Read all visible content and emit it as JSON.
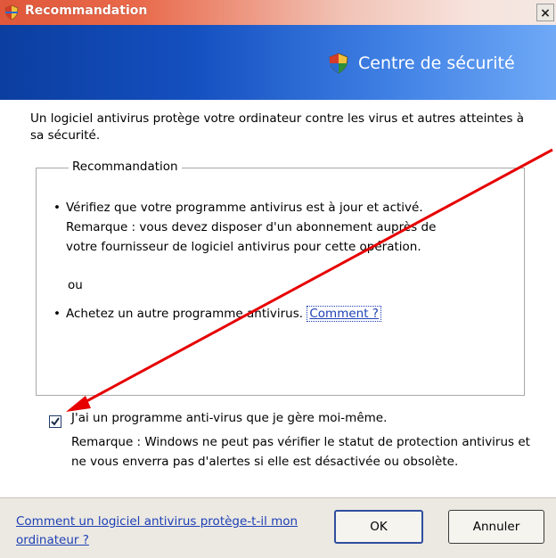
{
  "window": {
    "title": "Recommandation",
    "close_label": "×"
  },
  "banner": {
    "title": "Centre de sécurité"
  },
  "intro": "Un logiciel antivirus protège votre ordinateur contre les virus et autres atteintes à sa sécurité.",
  "group": {
    "legend": "Recommandation",
    "bullet1_line1": "Vérifiez que votre programme antivirus est à jour et activé.",
    "bullet1_line2": "Remarque : vous devez disposer d'un abonnement auprès de",
    "bullet1_line3": "votre fournisseur de logiciel antivirus pour cette opération.",
    "or": "ou",
    "bullet2_text": "Achetez un autre programme antivirus.",
    "bullet2_link": "Comment ?"
  },
  "checkbox": {
    "checked": true,
    "label": "J'ai un programme anti-virus que je gère moi-même.",
    "note": "Remarque : Windows ne peut pas vérifier le statut de protection antivirus et ne vous enverra pas d'alertes si elle est désactivée ou obsolète."
  },
  "footer": {
    "help_link": "Comment un logiciel antivirus protège-t-il mon ordinateur ?",
    "ok_label": "OK",
    "cancel_label": "Annuler"
  },
  "colors": {
    "banner": "#1550c0",
    "link": "#1d3fb5",
    "arrow": "#e60000"
  },
  "icons": {
    "title": "shield-icon",
    "banner": "shield-icon",
    "checkbox": "checkmark-icon"
  }
}
